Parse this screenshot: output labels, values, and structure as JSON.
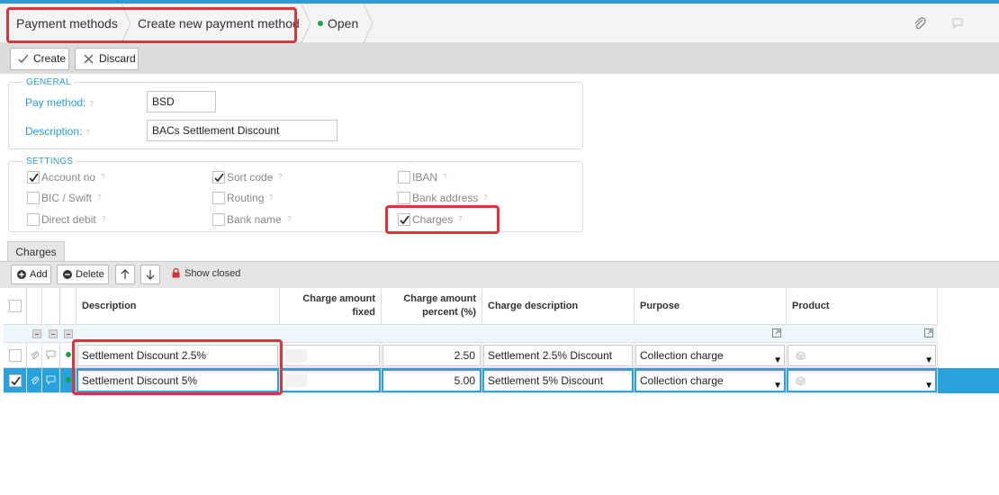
{
  "breadcrumb": {
    "items": [
      "Payment methods",
      "Create new payment method"
    ],
    "status": "Open"
  },
  "toolbar": {
    "create_label": "Create",
    "discard_label": "Discard"
  },
  "general": {
    "title": "GENERAL",
    "pay_method_label": "Pay method:",
    "pay_method_value": "BSD",
    "description_label": "Description:",
    "description_value": "BACs Settlement Discount"
  },
  "settings": {
    "title": "SETTINGS",
    "items": [
      {
        "label": "Account no",
        "checked": true
      },
      {
        "label": "Sort code",
        "checked": true
      },
      {
        "label": "IBAN",
        "checked": false
      },
      {
        "label": "BIC / Swift",
        "checked": false
      },
      {
        "label": "Routing",
        "checked": false
      },
      {
        "label": "Bank address",
        "checked": false
      },
      {
        "label": "Direct debit",
        "checked": false
      },
      {
        "label": "Bank name",
        "checked": false
      },
      {
        "label": "Charges",
        "checked": true
      }
    ]
  },
  "tabs": {
    "charges": "Charges"
  },
  "grid_toolbar": {
    "add_label": "Add",
    "delete_label": "Delete",
    "show_closed_label": "Show closed"
  },
  "grid": {
    "columns": {
      "description": "Description",
      "fixed_l1": "Charge amount",
      "fixed_l2": "fixed",
      "percent_l1": "Charge amount",
      "percent_l2": "percent (%)",
      "charge_description": "Charge description",
      "purpose": "Purpose",
      "product": "Product"
    },
    "rows": [
      {
        "description": "Settlement Discount 2.5%",
        "percent": "2.50",
        "charge_description": "Settlement 2.5% Discount",
        "purpose": "Collection charge",
        "selected": false
      },
      {
        "description": "Settlement Discount 5%",
        "percent": "5.00",
        "charge_description": "Settlement 5% Discount",
        "purpose": "Collection charge",
        "selected": true
      }
    ]
  },
  "colors": {
    "accent": "#2e9ad6",
    "highlight": "#d8363c",
    "selected_row": "#2aa0dc",
    "status_dot": "#1aa34a"
  }
}
